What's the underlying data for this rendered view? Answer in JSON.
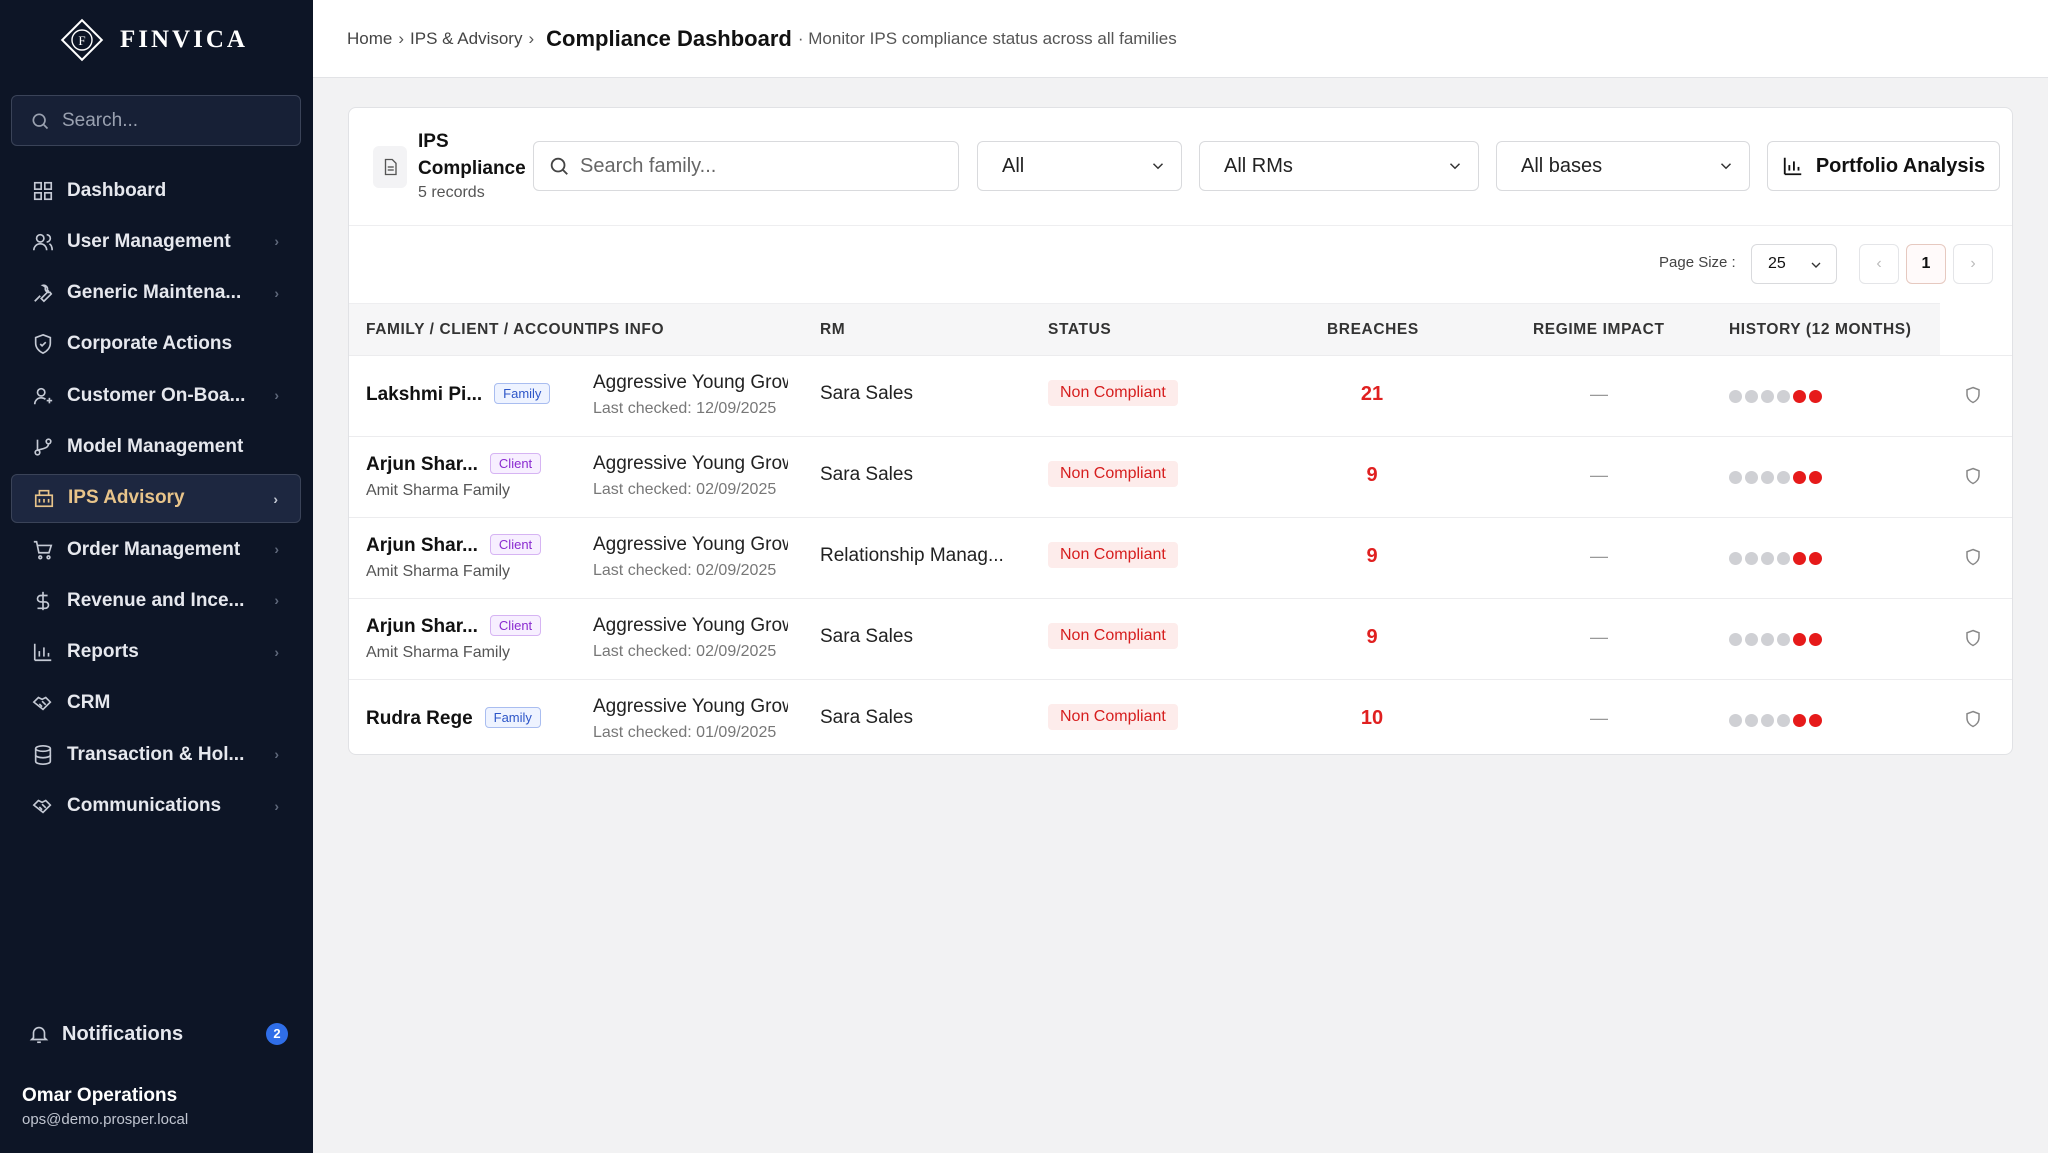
{
  "brand": {
    "name": "FINVICA",
    "monogram": "F"
  },
  "sidebar": {
    "search_placeholder": "Search...",
    "items": [
      {
        "label": "Dashboard",
        "icon": "grid-icon",
        "chevron": false
      },
      {
        "label": "User Management",
        "icon": "users-icon",
        "chevron": true
      },
      {
        "label": "Generic Maintena...",
        "icon": "wrench-icon",
        "chevron": true
      },
      {
        "label": "Corporate Actions",
        "icon": "shield-icon",
        "chevron": false
      },
      {
        "label": "Customer On-Boa...",
        "icon": "user-plus-icon",
        "chevron": true
      },
      {
        "label": "Model Management",
        "icon": "git-branch-icon",
        "chevron": false
      },
      {
        "label": "IPS Advisory",
        "icon": "building-icon",
        "chevron": true,
        "active": true
      },
      {
        "label": "Order Management",
        "icon": "cart-icon",
        "chevron": true
      },
      {
        "label": "Revenue and Ince...",
        "icon": "dollar-icon",
        "chevron": true
      },
      {
        "label": "Reports",
        "icon": "bar-chart-icon",
        "chevron": true
      },
      {
        "label": "CRM",
        "icon": "handshake-icon",
        "chevron": false
      },
      {
        "label": "Transaction & Hol...",
        "icon": "database-icon",
        "chevron": true
      },
      {
        "label": "Communications",
        "icon": "handshake-icon",
        "chevron": true
      }
    ],
    "notifications": {
      "label": "Notifications",
      "count": "2"
    },
    "user": {
      "name": "Omar Operations",
      "email": "ops@demo.prosper.local"
    }
  },
  "topbar": {
    "crumbs": [
      "Home",
      "IPS & Advisory"
    ],
    "title": "Compliance Dashboard",
    "subtitle": "· Monitor IPS compliance status across all families"
  },
  "card": {
    "title": "IPS Compliance",
    "count": "5 records",
    "search_placeholder": "Search family...",
    "filters": {
      "status": "All",
      "rm": "All RMs",
      "basis": "All bases"
    },
    "analysis_button": "Portfolio Analysis",
    "pager": {
      "label": "Page Size :",
      "size": "25",
      "page": "1"
    },
    "columns": [
      "FAMILY / CLIENT / ACCOUNT",
      "IPS INFO",
      "RM",
      "STATUS",
      "BREACHES",
      "REGIME IMPACT",
      "HISTORY (12 MONTHS)"
    ],
    "rows": [
      {
        "name": "Lakshmi Pi...",
        "tag": "Family",
        "sub": "",
        "ips": "Aggressive Young Growth",
        "checked": "Last checked: 12/09/2025",
        "rm": "Sara Sales",
        "status": "Non Compliant",
        "breaches": "21",
        "regime": "—",
        "history": [
          "grey",
          "grey",
          "grey",
          "grey",
          "red",
          "red"
        ]
      },
      {
        "name": "Arjun Shar...",
        "tag": "Client",
        "sub": "Amit Sharma Family",
        "ips": "Aggressive Young Growth",
        "checked": "Last checked: 02/09/2025",
        "rm": "Sara Sales",
        "status": "Non Compliant",
        "breaches": "9",
        "regime": "—",
        "history": [
          "grey",
          "grey",
          "grey",
          "grey",
          "red",
          "red"
        ]
      },
      {
        "name": "Arjun Shar...",
        "tag": "Client",
        "sub": "Amit Sharma Family",
        "ips": "Aggressive Young Growth",
        "checked": "Last checked: 02/09/2025",
        "rm": "Relationship Manag...",
        "status": "Non Compliant",
        "breaches": "9",
        "regime": "—",
        "history": [
          "grey",
          "grey",
          "grey",
          "grey",
          "red",
          "red"
        ]
      },
      {
        "name": "Arjun Shar...",
        "tag": "Client",
        "sub": "Amit Sharma Family",
        "ips": "Aggressive Young Growth",
        "checked": "Last checked: 02/09/2025",
        "rm": "Sara Sales",
        "status": "Non Compliant",
        "breaches": "9",
        "regime": "—",
        "history": [
          "grey",
          "grey",
          "grey",
          "grey",
          "red",
          "red"
        ]
      },
      {
        "name": "Rudra Rege",
        "tag": "Family",
        "sub": "",
        "ips": "Aggressive Young Growth",
        "checked": "Last checked: 01/09/2025",
        "rm": "Sara Sales",
        "status": "Non Compliant",
        "breaches": "10",
        "regime": "—",
        "history": [
          "grey",
          "grey",
          "grey",
          "grey",
          "red",
          "red"
        ]
      }
    ]
  },
  "colors": {
    "sidebar_bg": "#0d1526",
    "active_accent": "#e8c48a",
    "danger": "#e02020",
    "badge_blue": "#2f6ee8"
  }
}
